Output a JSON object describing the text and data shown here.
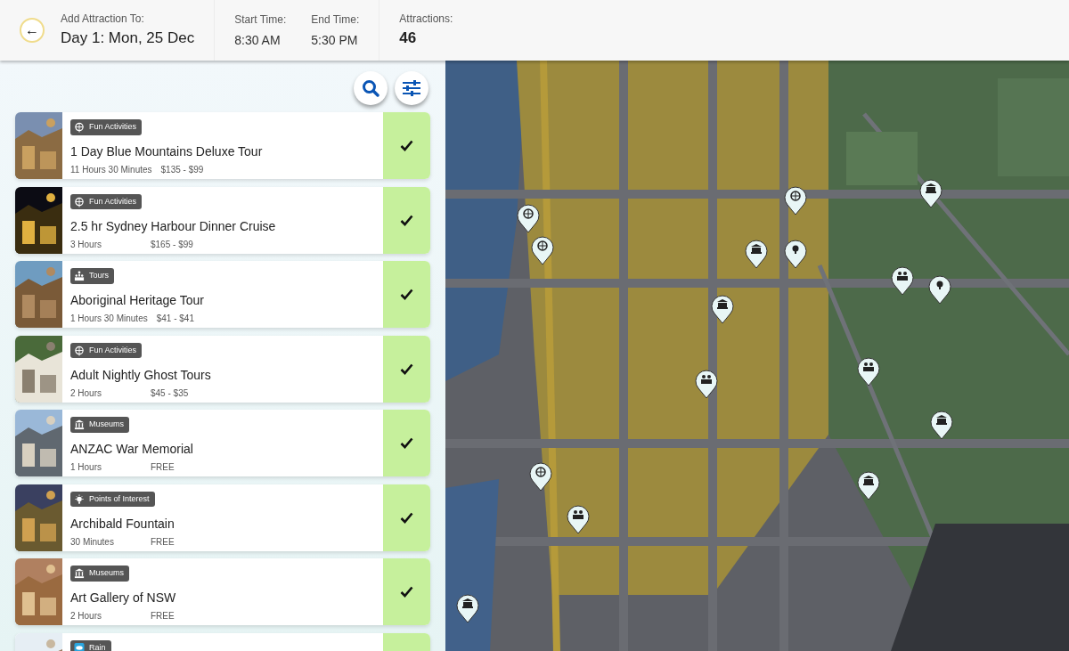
{
  "header": {
    "back_button": "←",
    "add_to_label": "Add Attraction To:",
    "day": "Day 1: Mon, 25 Dec",
    "start_label": "Start Time:",
    "start_time": "8:30 AM",
    "end_label": "End Time:",
    "end_time": "5:30 PM",
    "attractions_label": "Attractions:",
    "attractions_count": "46"
  },
  "attractions": [
    {
      "category": "Fun Activities",
      "kind": "fun",
      "name": "1 Day Blue Mountains Deluxe Tour",
      "duration": "11 Hours 30 Minutes",
      "price": "$135 - $99",
      "selected": true
    },
    {
      "category": "Fun Activities",
      "kind": "fun",
      "name": "2.5 hr Sydney Harbour Dinner Cruise",
      "duration": "3 Hours",
      "price": "$165 - $99",
      "selected": true
    },
    {
      "category": "Tours",
      "kind": "tours",
      "name": "Aboriginal Heritage Tour",
      "duration": "1 Hours 30 Minutes",
      "price": "$41 - $41",
      "selected": true
    },
    {
      "category": "Fun Activities",
      "kind": "fun",
      "name": "Adult Nightly Ghost Tours",
      "duration": "2 Hours",
      "price": "$45 - $35",
      "selected": true
    },
    {
      "category": "Museums",
      "kind": "museum",
      "name": "ANZAC War Memorial",
      "duration": "1 Hours",
      "price": "FREE",
      "selected": true
    },
    {
      "category": "Points of Interest",
      "kind": "poi",
      "name": "Archibald Fountain",
      "duration": "30 Minutes",
      "price": "FREE",
      "selected": true
    },
    {
      "category": "Museums",
      "kind": "museum",
      "name": "Art Gallery of NSW",
      "duration": "2 Hours",
      "price": "FREE",
      "selected": true
    },
    {
      "category": "Rain",
      "kind": "rain",
      "selected": true
    }
  ]
}
